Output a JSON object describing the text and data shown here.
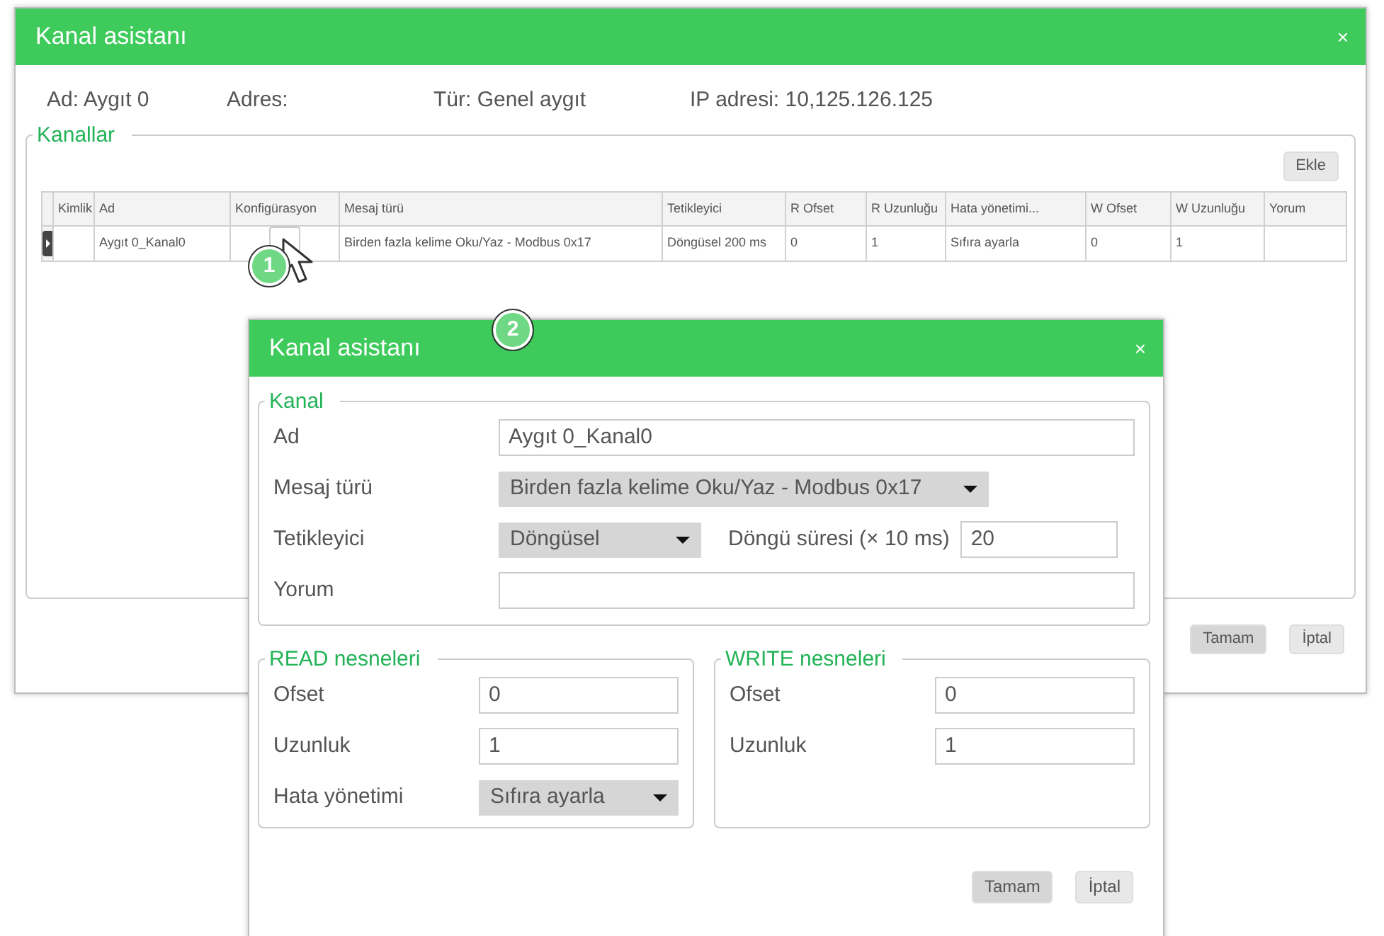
{
  "main_dialog": {
    "title": "Kanal asistanı",
    "close": "×",
    "info": [
      "Ad: Aygıt 0",
      "Adres:",
      "Tür: Genel aygıt",
      "IP adresi: 10,125.126.125"
    ],
    "channels": {
      "legend": "Kanallar",
      "add_button": "Ekle",
      "columns": [
        "Kimlik",
        "Ad",
        "Konfigürasyon",
        "Mesaj türü",
        "Tetikleyici",
        "R Ofset",
        "R Uzunluğu",
        "Hata yönetimi...",
        "W Ofset",
        "W Uzunluğu",
        "Yorum"
      ],
      "rows": [
        {
          "current": true,
          "cells": [
            {},
            {
              "text": "Aygıt 0_Kanal0"
            },
            {
              "kind": "button"
            },
            {
              "text": "Birden fazla kelime Oku/Yaz - Modbus 0x17"
            },
            {
              "text": "Döngüsel 200 ms"
            },
            {
              "text": "0"
            },
            {
              "text": "1"
            },
            {
              "text": "Sıfıra ayarla"
            },
            {
              "text": "0"
            },
            {
              "text": "1"
            },
            {}
          ]
        }
      ]
    },
    "buttons": [
      {
        "label": "Tamam",
        "default": true
      },
      {
        "label": "İptal",
        "default": false
      }
    ]
  },
  "callouts": [
    "1",
    "2"
  ],
  "channel_dialog": {
    "title": "Kanal asistanı",
    "close": "×",
    "channel": {
      "legend": "Kanal",
      "fields": [
        {
          "label": "Ad",
          "kind": "text",
          "value": "Aygıt 0_Kanal0"
        },
        {
          "label": "Mesaj türü",
          "kind": "select",
          "value": "Birden fazla kelime Oku/Yaz - Modbus 0x17"
        },
        {
          "label": "Tetikleyici",
          "kind": "select",
          "value": "Döngüsel",
          "extra": {
            "label": "Döngü süresi (× 10 ms)",
            "value": "20"
          }
        },
        {
          "label": "Yorum",
          "kind": "text"
        }
      ]
    },
    "read": {
      "legend": "READ nesneleri",
      "fields": [
        {
          "label": "Ofset",
          "kind": "text",
          "value": "0"
        },
        {
          "label": "Uzunluk",
          "kind": "text",
          "value": "1"
        },
        {
          "label": "Hata yönetimi",
          "kind": "select",
          "value": "Sıfıra ayarla"
        }
      ]
    },
    "write": {
      "legend": "WRITE nesneleri",
      "fields": [
        {
          "label": "Ofset",
          "kind": "text",
          "value": "0"
        },
        {
          "label": "Uzunluk",
          "kind": "text",
          "value": "1"
        }
      ]
    },
    "buttons": [
      {
        "label": "Tamam",
        "default": true
      },
      {
        "label": "İptal",
        "default": false
      }
    ]
  }
}
